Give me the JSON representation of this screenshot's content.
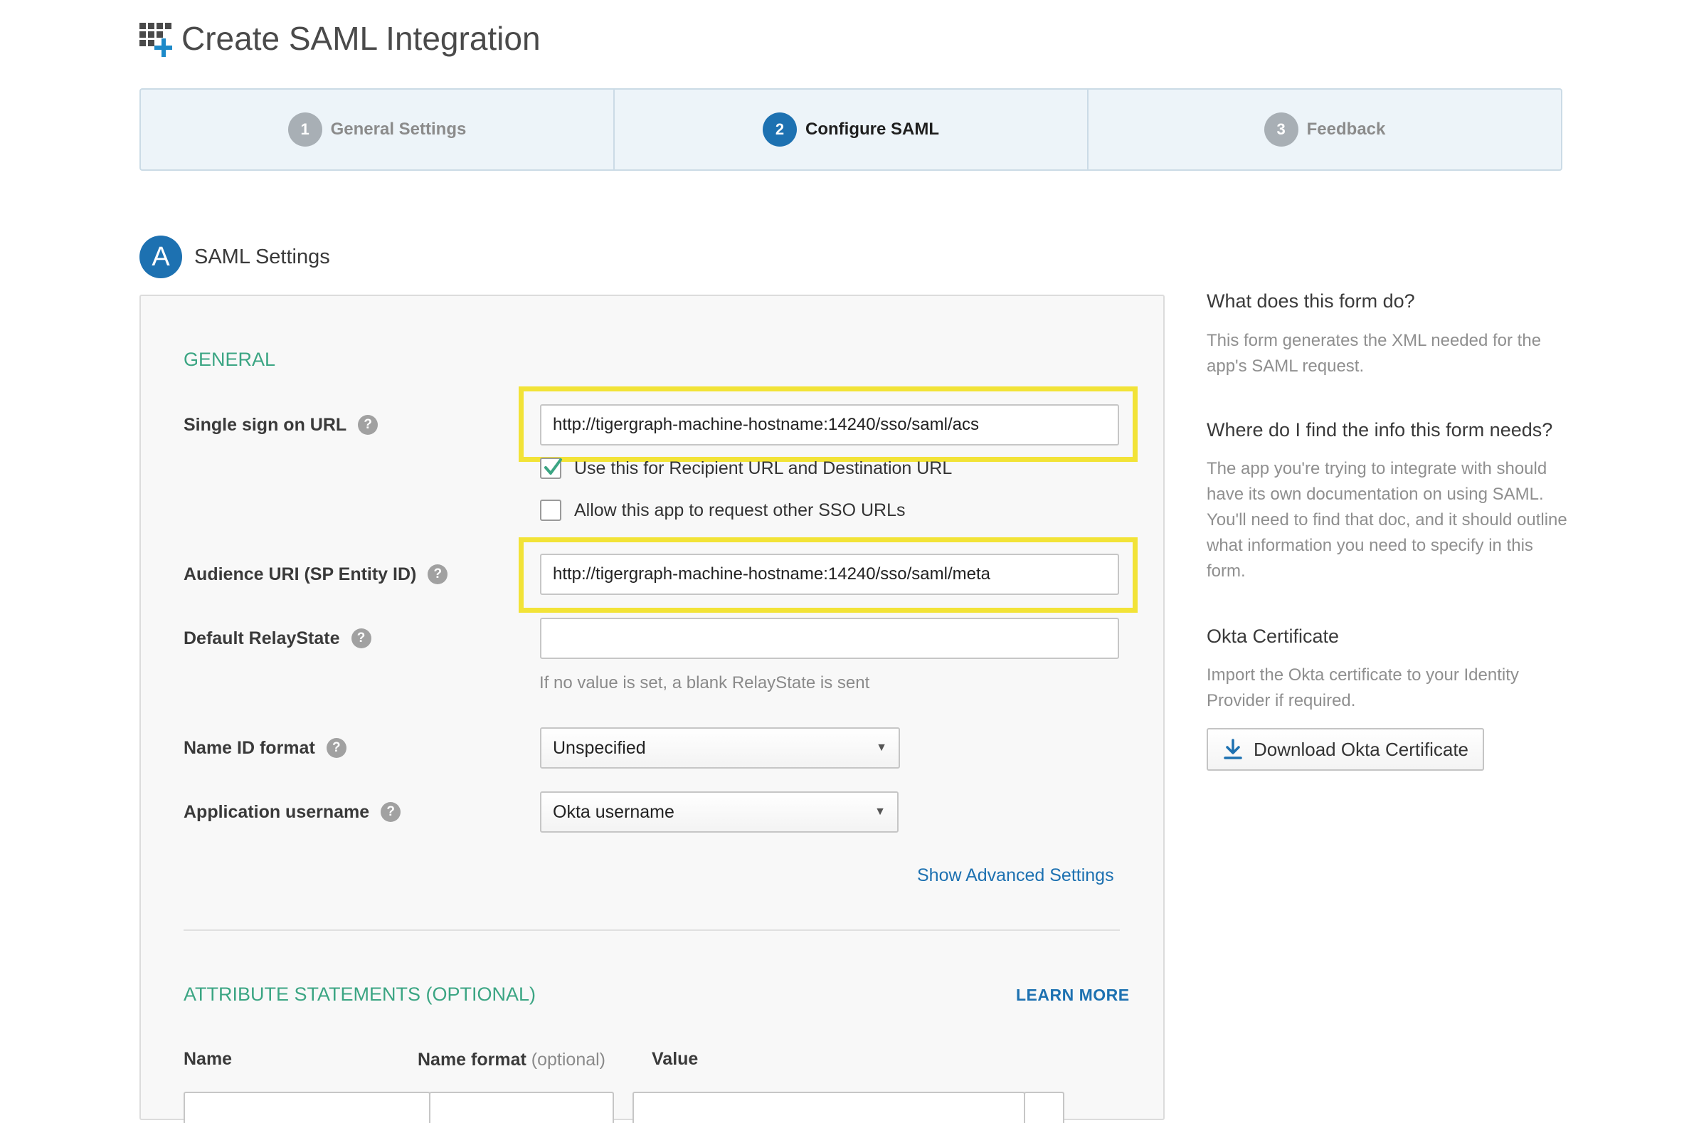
{
  "page": {
    "title": "Create SAML Integration",
    "title_icon": "grid-plus-icon"
  },
  "wizard": {
    "steps": [
      {
        "number": "1",
        "label": "General Settings",
        "active": false
      },
      {
        "number": "2",
        "label": "Configure SAML",
        "active": true
      },
      {
        "number": "3",
        "label": "Feedback",
        "active": false
      }
    ]
  },
  "section": {
    "badge": "A",
    "title": "SAML Settings"
  },
  "general": {
    "heading": "GENERAL",
    "sso_url": {
      "label": "Single sign on URL",
      "value": "http://tigergraph-machine-hostname:14240/sso/saml/acs"
    },
    "recipient_checkbox": {
      "label": "Use this for Recipient URL and Destination URL",
      "checked": true
    },
    "other_sso_checkbox": {
      "label": "Allow this app to request other SSO URLs",
      "checked": false
    },
    "audience_uri": {
      "label": "Audience URI (SP Entity ID)",
      "value": "http://tigergraph-machine-hostname:14240/sso/saml/meta"
    },
    "relay_state": {
      "label": "Default RelayState",
      "value": "",
      "hint": "If no value is set, a blank RelayState is sent"
    },
    "name_id_format": {
      "label": "Name ID format",
      "selected": "Unspecified"
    },
    "app_username": {
      "label": "Application username",
      "selected": "Okta username"
    },
    "advanced_link": "Show Advanced Settings"
  },
  "attributes": {
    "heading": "ATTRIBUTE STATEMENTS (OPTIONAL)",
    "learn_more": "LEARN MORE",
    "columns": {
      "name": "Name",
      "name_format": "Name format",
      "name_format_hint": "(optional)",
      "value": "Value"
    }
  },
  "help_glyph": "?",
  "sidebar": {
    "q1_title": "What does this form do?",
    "q1_text": "This form generates the XML needed for the app's SAML request.",
    "q2_title": "Where do I find the info this form needs?",
    "q2_text": "The app you're trying to integrate with should have its own documentation on using SAML. You'll need to find that doc, and it should outline what information you need to specify in this form.",
    "cert_title": "Okta Certificate",
    "cert_text": "Import the Okta certificate to your Identity Provider if required.",
    "download_label": "Download Okta Certificate"
  },
  "colors": {
    "accent": "#1d71b1",
    "group_heading": "#3ba583",
    "highlight": "#f2e337",
    "check": "#3ba583"
  }
}
